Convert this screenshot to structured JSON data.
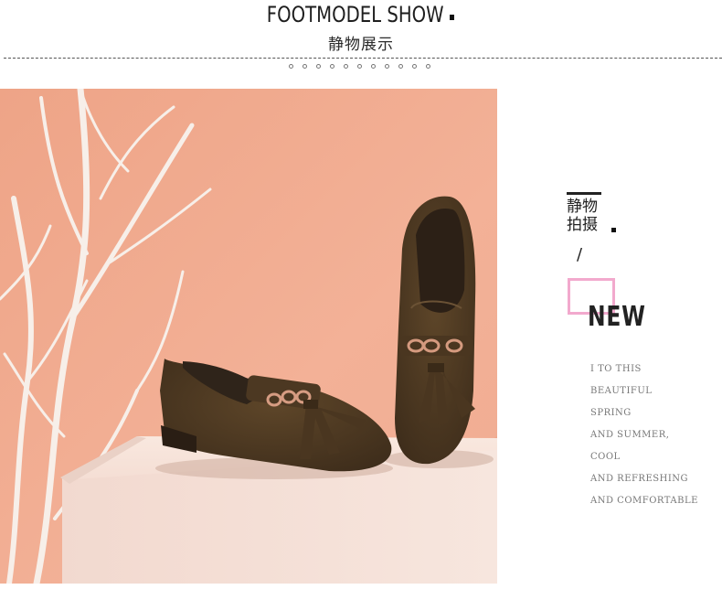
{
  "header": {
    "title": "FOOTMODEL SHOW",
    "subtitle": "静物展示"
  },
  "side": {
    "tag_line1": "静物",
    "tag_line2": "拍摄",
    "slash": "/",
    "new_label": "NEW",
    "copy_lines": [
      "I TO THIS",
      "BEAUTIFUL",
      "SPRING",
      "AND SUMMER,",
      "COOL",
      "AND REFRESHING",
      "AND COMFORTABLE"
    ]
  },
  "colors": {
    "background_wall": "#f0a98c",
    "pedestal": "#f6e3db",
    "shoe_suede": "#4f3a23",
    "accent_box": "#f2a9cd"
  }
}
